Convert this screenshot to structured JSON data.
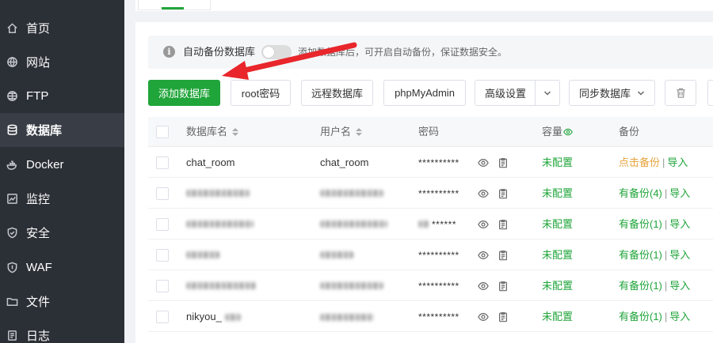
{
  "sidebar": {
    "items": [
      {
        "label": "首页",
        "icon": "home-icon"
      },
      {
        "label": "网站",
        "icon": "globe-icon"
      },
      {
        "label": "FTP",
        "icon": "ftp-globe-icon"
      },
      {
        "label": "数据库",
        "icon": "database-icon",
        "active": true
      },
      {
        "label": "Docker",
        "icon": "docker-icon"
      },
      {
        "label": "监控",
        "icon": "monitor-icon"
      },
      {
        "label": "安全",
        "icon": "shield-icon"
      },
      {
        "label": "WAF",
        "icon": "waf-shield-icon"
      },
      {
        "label": "文件",
        "icon": "folder-icon"
      },
      {
        "label": "日志",
        "icon": "log-icon"
      }
    ]
  },
  "notice": {
    "label": "自动备份数据库",
    "text": "添加数据库后，可开启自动备份，保证数据安全。",
    "toggle_on": false
  },
  "toolbar": {
    "add_database": "添加数据库",
    "root_password": "root密码",
    "remote_database": "远程数据库",
    "phpmyadmin": "phpMyAdmin",
    "advanced_settings": "高级设置",
    "sync_database": "同步数据库"
  },
  "table": {
    "headers": {
      "db_name": "数据库名",
      "username": "用户名",
      "password": "密码",
      "capacity": "容量",
      "backup": "备份"
    },
    "rows": [
      {
        "db_name": "chat_room",
        "username": "chat_room",
        "password": "**********",
        "capacity": "未配置",
        "backup": "点击备份",
        "backup_state": "none",
        "import": "导入"
      },
      {
        "db_name": "",
        "username": "",
        "password": "**********",
        "capacity": "未配置",
        "backup": "有备份(4)",
        "backup_state": "has",
        "import": "导入"
      },
      {
        "db_name": "",
        "username": "",
        "password": "******",
        "capacity": "未配置",
        "backup": "有备份(1)",
        "backup_state": "has",
        "import": "导入"
      },
      {
        "db_name": "",
        "username": "",
        "password": "**********",
        "capacity": "未配置",
        "backup": "有备份(1)",
        "backup_state": "has",
        "import": "导入"
      },
      {
        "db_name": "",
        "username": "",
        "password": "**********",
        "capacity": "未配置",
        "backup": "有备份(1)",
        "backup_state": "has",
        "import": "导入"
      },
      {
        "db_name": "nikyou_",
        "username": "",
        "password": "**********",
        "capacity": "未配置",
        "backup": "有备份(1)",
        "backup_state": "has",
        "import": "导入"
      }
    ]
  },
  "colors": {
    "accent": "#20a53a",
    "sidebar_bg": "#2b2f36",
    "warning": "#e8a33d",
    "annotation_arrow": "#e8262b"
  }
}
